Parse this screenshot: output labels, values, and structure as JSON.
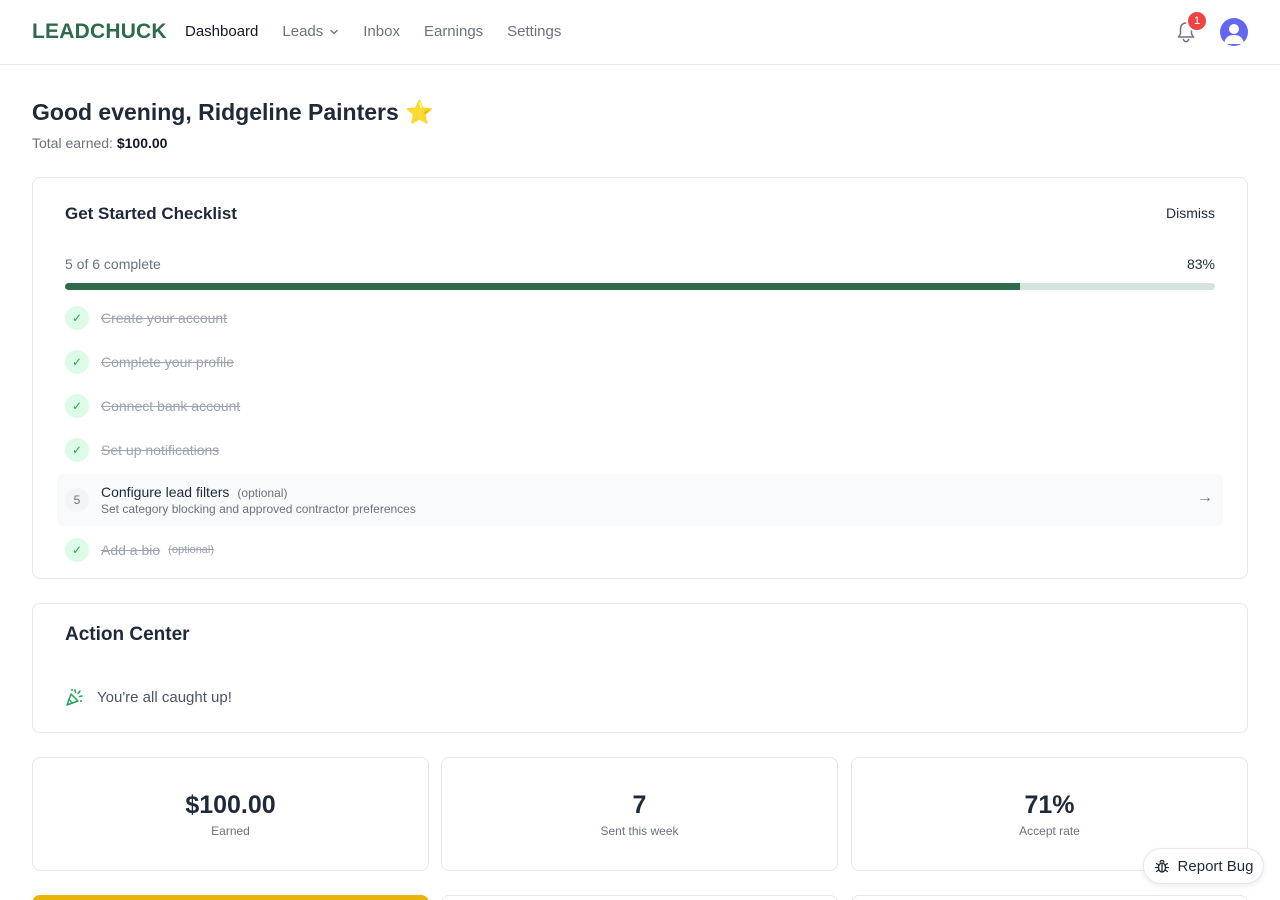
{
  "nav": {
    "logo": "LEADCHUCK",
    "links": [
      {
        "label": "Dashboard",
        "active": true
      },
      {
        "label": "Leads",
        "dropdown": true
      },
      {
        "label": "Inbox"
      },
      {
        "label": "Earnings"
      },
      {
        "label": "Settings"
      }
    ],
    "notification_count": "1",
    "bell_icon": "bell-icon",
    "avatar_icon": "user-avatar-icon"
  },
  "greeting": {
    "text": "Good evening, Ridgeline Painters",
    "emoji": "⭐",
    "earned_label": "Total earned:",
    "earned_value": "$100.00"
  },
  "checklist": {
    "title": "Get Started Checklist",
    "dismiss_label": "Dismiss",
    "progress_label": "5 of 6 complete",
    "progress_pct_label": "83%",
    "progress_fraction": 0.83,
    "items": [
      {
        "label": "Create your account",
        "done": true
      },
      {
        "label": "Complete your profile",
        "done": true
      },
      {
        "label": "Connect bank account",
        "done": true
      },
      {
        "label": "Set up notifications",
        "done": true
      },
      {
        "number": "5",
        "label": "Configure lead filters",
        "optional": "(optional)",
        "description": "Set category blocking and approved contractor preferences",
        "done": false
      },
      {
        "label": "Add a bio",
        "optional": "(optional)",
        "done": true
      }
    ]
  },
  "action_center": {
    "title": "Action Center",
    "message": "You're all caught up!",
    "icon": "party-popper-icon"
  },
  "stats": [
    {
      "value": "$100.00",
      "label": "Earned"
    },
    {
      "value": "7",
      "label": "Sent this week"
    },
    {
      "value": "71%",
      "label": "Accept rate"
    }
  ],
  "report_bug": {
    "label": "Report Bug",
    "icon": "bug-icon"
  },
  "colors": {
    "brand": "#2f6b4b",
    "badge": "#ef4444",
    "avatar": "#6366f1",
    "check": "#22a35a",
    "highlight": "#eab308"
  }
}
